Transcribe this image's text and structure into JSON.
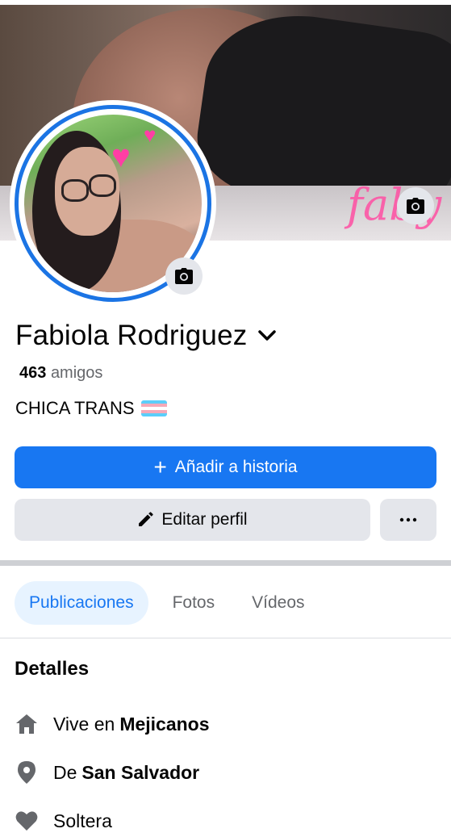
{
  "profile": {
    "name": "Fabiola Rodriguez",
    "friends_count": "463",
    "friends_label": "amigos",
    "bio": "CHICA TRANS",
    "cover_watermark": "faby"
  },
  "actions": {
    "add_story": "Añadir a historia",
    "edit_profile": "Editar perfil",
    "more": "···"
  },
  "tabs": [
    {
      "label": "Publicaciones",
      "active": true
    },
    {
      "label": "Fotos",
      "active": false
    },
    {
      "label": "Vídeos",
      "active": false
    }
  ],
  "details": {
    "title": "Detalles",
    "items": [
      {
        "icon": "home-icon",
        "prefix": "Vive en",
        "value": "Mejicanos"
      },
      {
        "icon": "location-pin-icon",
        "prefix": "De",
        "value": "San Salvador"
      },
      {
        "icon": "heart-icon",
        "prefix": "Soltera",
        "value": ""
      }
    ]
  },
  "colors": {
    "primary": "#1877f2",
    "secondary_button": "#e4e6eb",
    "active_tab_bg": "#e7f3ff",
    "muted_text": "#65676b",
    "flag_blue": "#5bcefa",
    "flag_pink": "#f5a9b8",
    "flag_white": "#ffffff"
  }
}
